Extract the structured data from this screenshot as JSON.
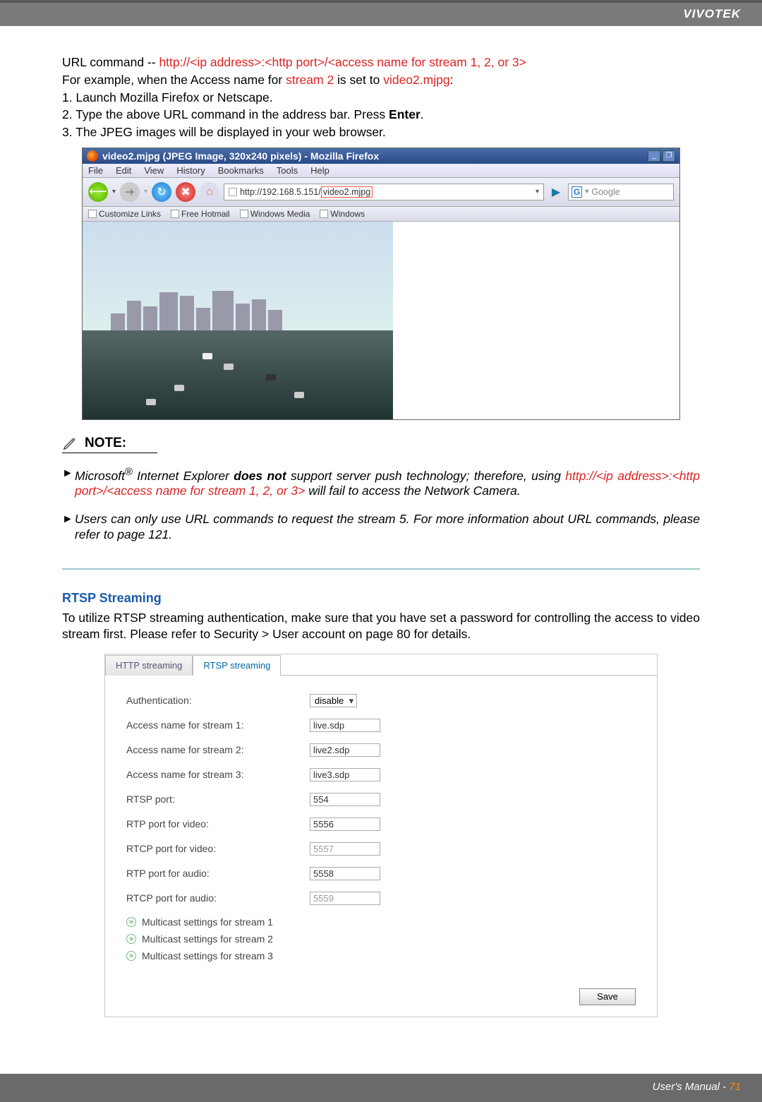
{
  "brand": "VIVOTEK",
  "intro": {
    "line1_prefix": "URL command -- ",
    "line1_red": "http://<ip address>:<http port>/<access name for stream 1, 2, or 3>",
    "line2_a": "For example, when the Access name for ",
    "line2_red1": "stream 2",
    "line2_b": " is set to ",
    "line2_red2": "video2.mjpg",
    "line2_c": ":",
    "step1": "1. Launch Mozilla Firefox or Netscape.",
    "step2_a": "2. Type the above URL command in the address bar. Press ",
    "step2_b": "Enter",
    "step2_c": ".",
    "step3": "3. The JPEG images will be displayed in your web browser."
  },
  "firefox": {
    "title": "video2.mjpg (JPEG Image, 320x240 pixels) - Mozilla Firefox",
    "menu": [
      "File",
      "Edit",
      "View",
      "History",
      "Bookmarks",
      "Tools",
      "Help"
    ],
    "address_prefix": "http://192.168.5.151/",
    "address_hl": "video2.mjpg",
    "search_engine": "G",
    "search_placeholder": "Google",
    "bookmarks": [
      "Customize Links",
      "Free Hotmail",
      "Windows Media",
      "Windows"
    ]
  },
  "note": {
    "heading": "NOTE:",
    "item1_a": "Microsoft",
    "item1_sup": "®",
    "item1_b": " Internet Explorer ",
    "item1_bold": "does not",
    "item1_c": " support server push technology; therefore, using ",
    "item1_red": "http://<ip address>:<http port>/<access name for stream 1, 2, or 3>",
    "item1_d": " will fail to access the Network Camera.",
    "item2": "Users can only use URL commands to request the stream 5. For more information about URL commands, please refer to page 121."
  },
  "rtsp": {
    "heading": "RTSP Streaming",
    "para": "To utilize RTSP streaming authentication, make sure that you have set a password for controlling the access to video stream first. Please refer to Security > User account on page 80 for details."
  },
  "tabs": {
    "http": "HTTP streaming",
    "rtsp": "RTSP streaming"
  },
  "form": {
    "auth_label": "Authentication:",
    "auth_value": "disable",
    "s1_label": "Access name for stream 1:",
    "s1_value": "live.sdp",
    "s2_label": "Access name for stream 2:",
    "s2_value": "live2.sdp",
    "s3_label": "Access name for stream 3:",
    "s3_value": "live3.sdp",
    "rtsp_port_label": "RTSP port:",
    "rtsp_port_value": "554",
    "rtp_v_label": "RTP port for video:",
    "rtp_v_value": "5556",
    "rtcp_v_label": "RTCP port for video:",
    "rtcp_v_value": "5557",
    "rtp_a_label": "RTP port for audio:",
    "rtp_a_value": "5558",
    "rtcp_a_label": "RTCP port for audio:",
    "rtcp_a_value": "5559",
    "mc1": "Multicast settings for stream 1",
    "mc2": "Multicast settings for stream 2",
    "mc3": "Multicast settings for stream 3",
    "save": "Save"
  },
  "footer": {
    "label": "User's Manual - ",
    "page": "71"
  }
}
